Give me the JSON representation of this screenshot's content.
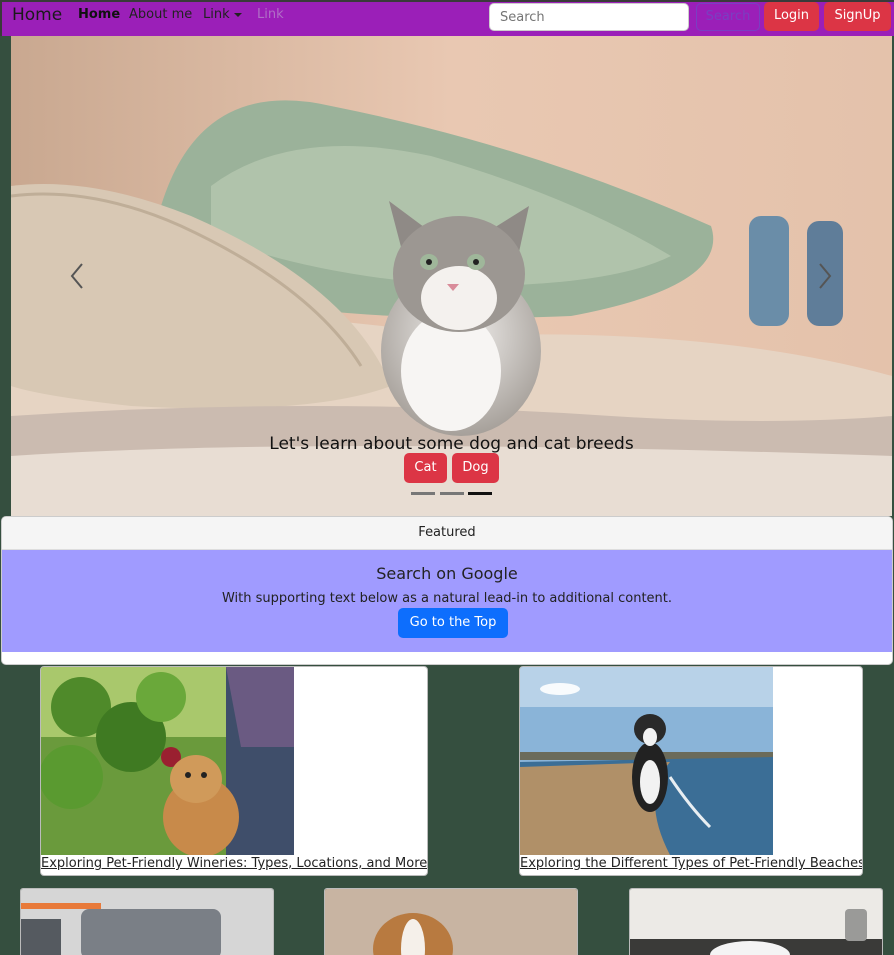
{
  "navbar": {
    "brand": "Home",
    "links": [
      {
        "label": "Home",
        "active": true
      },
      {
        "label": "About me"
      },
      {
        "label": "Link"
      },
      {
        "label": "Link",
        "disabled": true
      }
    ],
    "search_placeholder": "Search",
    "search_button": "Search",
    "login_button": "Login",
    "signup_button": "SignUp",
    "colors": {
      "navbar_bg": "#9b1fb8",
      "danger": "#dc3545"
    }
  },
  "carousel": {
    "caption": "Let's learn about some dog and cat breeds",
    "buttons": [
      "Cat",
      "Dog"
    ],
    "indicators_count": 3,
    "active_indicator": 3,
    "prev_icon": "chevron-left-icon",
    "next_icon": "chevron-right-icon"
  },
  "featured": {
    "header": "Featured",
    "title": "Search on Google",
    "text": "With supporting text below as a natural lead-in to additional content.",
    "button": "Go to the Top",
    "colors": {
      "body_bg": "#a09bff",
      "button_bg": "#0d6efd"
    }
  },
  "articles": [
    {
      "title": "Exploring Pet-Friendly Wineries: Types, Locations, and More"
    },
    {
      "title": "Exploring the Different Types of Pet-Friendly Beaches"
    }
  ],
  "page": {
    "background": "#354f3f"
  }
}
